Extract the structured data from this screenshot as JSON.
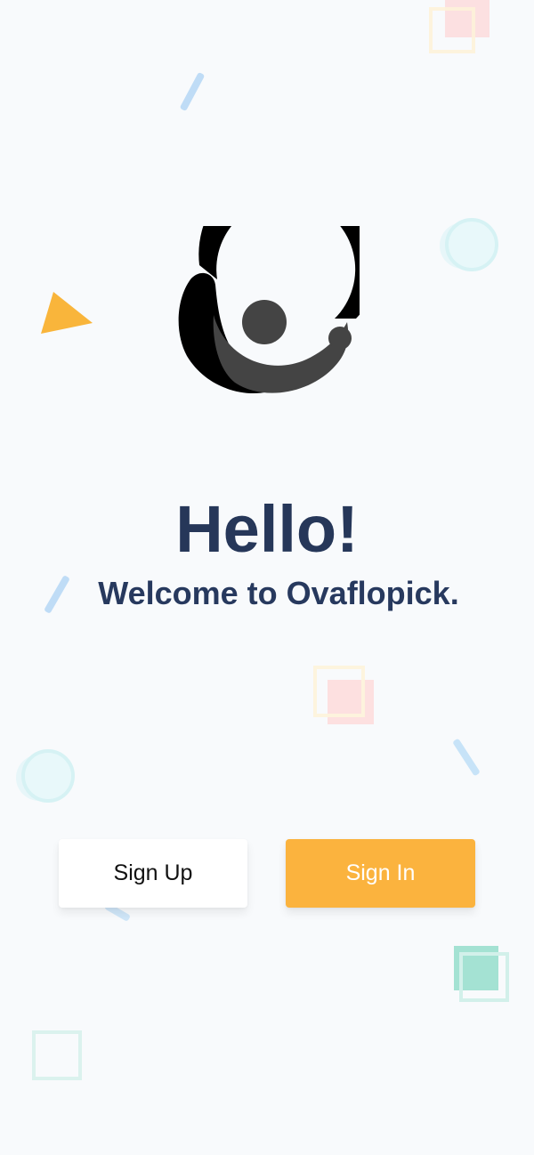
{
  "welcome": {
    "greeting": "Hello!",
    "message": "Welcome to Ovaflopick."
  },
  "actions": {
    "sign_up_label": "Sign Up",
    "sign_in_label": "Sign In"
  },
  "colors": {
    "background": "#f8fafc",
    "heading_text": "#263759",
    "sign_in_background": "#fbb33e",
    "sign_in_text": "#ffffff",
    "sign_up_background": "#ffffff",
    "sign_up_text": "#111111",
    "logo_primary": "#000000",
    "logo_secondary": "#444444"
  },
  "icons": {
    "logo": "ovaflopick-logo-icon"
  }
}
